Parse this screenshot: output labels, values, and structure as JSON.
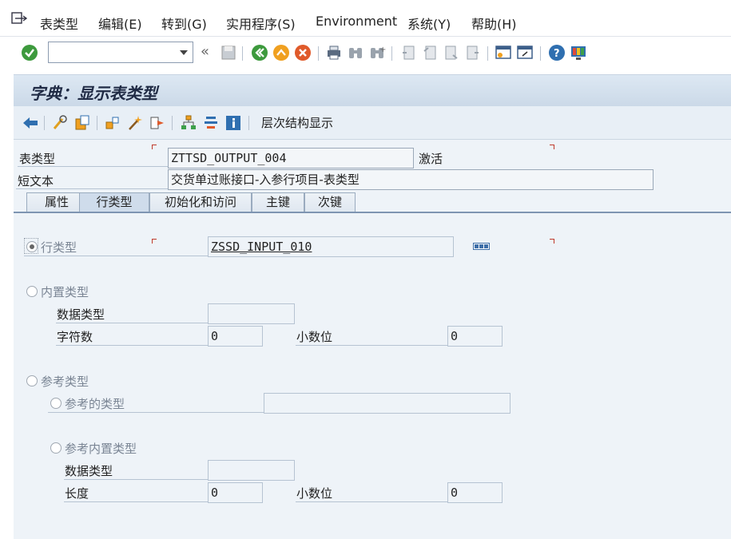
{
  "menu": {
    "items": [
      "表类型",
      "编辑(E)",
      "转到(G)",
      "实用程序(S)",
      "Environment",
      "系统(Y)",
      "帮助(H)"
    ]
  },
  "toolbar": {
    "command_field": "",
    "icons": [
      "enter-icon",
      "save-icon",
      "back-icon",
      "exit-icon",
      "cancel-icon",
      "print-icon",
      "find-icon",
      "find-next-icon",
      "first-page-icon",
      "prev-page-icon",
      "next-page-icon",
      "last-page-icon",
      "new-session-icon",
      "shortcut-icon",
      "help-icon",
      "customize-icon"
    ]
  },
  "title": "字典：显示表类型",
  "app_toolbar": {
    "hierarchy_label": "层次结构显示"
  },
  "header": {
    "table_type_label": "表类型",
    "table_type_value": "ZTTSD_OUTPUT_004",
    "status": "激活",
    "short_text_label": "短文本",
    "short_text_value": "交货单过账接口-入参行项目-表类型"
  },
  "tabs": [
    "属性",
    "行类型",
    "初始化和访问",
    "主键",
    "次键"
  ],
  "active_tab": "行类型",
  "line_type": {
    "row_type_label": "行类型",
    "row_type_value": "ZSSD_INPUT_010",
    "builtin_label": "内置类型",
    "data_type_label": "数据类型",
    "data_type_value": "",
    "chars_label": "字符数",
    "chars_value": "0",
    "decimals_label": "小数位",
    "decimals_value": "0",
    "ref_label": "参考类型",
    "ref_type_label": "参考的类型",
    "ref_type_value": "",
    "ref_builtin_label": "参考内置类型",
    "ref_data_type_label": "数据类型",
    "ref_data_type_value": "",
    "length_label": "长度",
    "length_value": "0",
    "ref_decimals_label": "小数位",
    "ref_decimals_value": "0"
  }
}
